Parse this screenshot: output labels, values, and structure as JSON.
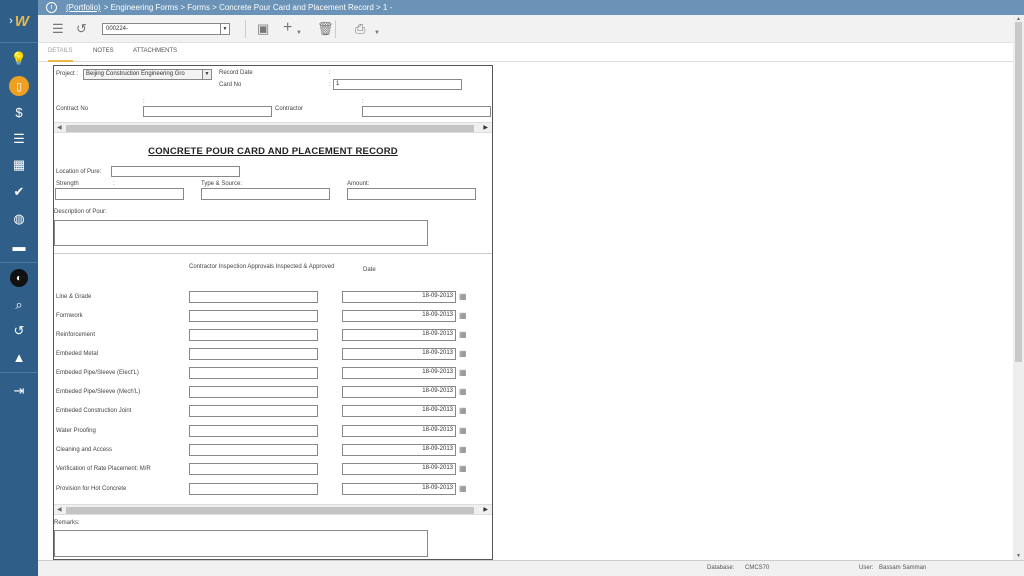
{
  "breadcrumb": {
    "portfolio": "(Portfolio)",
    "rest": "> Engineering Forms > Forms > Concrete Pour Card and Placement Record > 1 -"
  },
  "toolbar": {
    "record_select_value": "000224-"
  },
  "tabs": [
    "DETAILS",
    "NOTES",
    "ATTACHMENTS"
  ],
  "header": {
    "project_label": "Project :",
    "project_value": "Beijing Construction Engineering Gro",
    "record_date_label": "Record Date",
    "record_date_colon": ":",
    "card_no_label": "Card No",
    "card_no_colon": ":",
    "card_no_value": "1",
    "contract_no_label": "Contract No",
    "contract_no_colon": ":",
    "contractor_label": "Contractor",
    "contractor_colon": ":"
  },
  "form": {
    "title": "CONCRETE POUR CARD AND PLACEMENT RECORD",
    "location_label": "Location of Pure:",
    "strength_label": "Strength",
    "strength_colon": ":",
    "type_source_label": "Type & Source:",
    "amount_label": "Amount:",
    "description_label": "Description of Pour:",
    "inspection_header": "Contractor Inspection Approvals Inspected & Approved",
    "date_header": "Date",
    "rows": [
      {
        "label": "Line & Grade",
        "date": "18-09-2013"
      },
      {
        "label": "Formwork",
        "date": "18-09-2013"
      },
      {
        "label": "Reinforcement",
        "date": "18-09-2013"
      },
      {
        "label": "Embeded Metal",
        "date": "18-09-2013"
      },
      {
        "label": "Embeded Pipe/Sleeve (Elect'L)",
        "date": "18-09-2013"
      },
      {
        "label": "Embeded Pipe/Sleeve (Mech'L)",
        "date": "18-09-2013"
      },
      {
        "label": "Embeded Construction Joint",
        "date": "18-09-2013"
      },
      {
        "label": "Water Proofing",
        "date": "18-09-2013"
      },
      {
        "label": "Cleaning and Access",
        "date": "18-09-2013"
      },
      {
        "label": "Verification of Rate Placement: M/R",
        "date": "18-09-2013"
      },
      {
        "label": "Provision for Hot Concrete",
        "date": "18-09-2013"
      }
    ],
    "remarks_label": "Remarks:"
  },
  "status": {
    "database_label": "Database:",
    "database_value": "CMCS70",
    "user_label": "User:",
    "user_value": "Bassam Samman"
  },
  "colors": {
    "sidebar": "#2f5f88",
    "topbar": "#6a93b7",
    "accent": "#f0a020"
  }
}
